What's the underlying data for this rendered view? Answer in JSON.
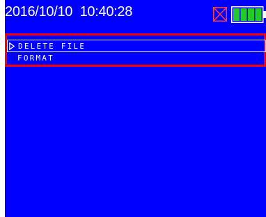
{
  "status_bar": {
    "datetime": "2016/10/10  10:40:28",
    "sd_card_icon": "sd-card-error-icon",
    "battery_icon": "battery-full-icon",
    "battery_level": 4,
    "battery_max": 4
  },
  "menu": {
    "items": [
      {
        "label": "DELETE FILE",
        "selected": true
      },
      {
        "label": "FORMAT",
        "selected": false
      }
    ],
    "cursor_icon": "triangle-right-icon"
  },
  "colors": {
    "screen_background": "#0000ff",
    "text": "#ffffff",
    "highlight_frame": "#ff0000",
    "battery_fill": "#22cc22"
  }
}
